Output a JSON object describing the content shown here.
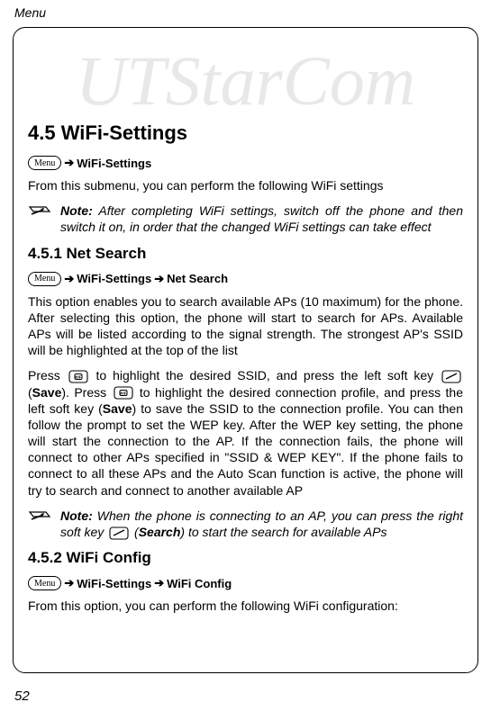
{
  "header": "Menu",
  "sections": {
    "s45": {
      "title": "4.5 WiFi-Settings",
      "nav_menu": "Menu",
      "nav1": "WiFi-Settings",
      "intro": "From this submenu, you can perform the following WiFi settings",
      "note_label": "Note:",
      "note": "After completing WiFi settings, switch off the phone and then switch it on, in order that the changed WiFi settings can take effect"
    },
    "s451": {
      "title": "4.5.1 Net Search",
      "nav_menu": "Menu",
      "nav1": "WiFi-Settings",
      "nav2": "Net Search",
      "p1": "This option enables you to search available APs (10 maximum) for the phone. After selecting this option, the phone will start to search for APs. Available APs will be listed according to the signal strength. The strongest AP's SSID will be highlighted at the top of the list",
      "p2a": "Press",
      "p2b": "to highlight the desired SSID, and press the left soft key",
      "p2c": "(",
      "save1": "Save",
      "p2d": "). Press",
      "p2e": "to highlight the desired connection profile, and press the left soft key (",
      "save2": "Save",
      "p2f": ") to save the SSID to the connection profile. You can then follow the prompt to set the WEP key. After the WEP key setting, the phone will start the connection to the AP. If the connection fails, the phone will connect to other APs specified in \"SSID & WEP KEY\". If the phone fails to connect to all these APs and the Auto Scan function is active, the phone will try to search and connect to another available AP",
      "note_label": "Note:",
      "note_a": "When the phone is connecting to an AP, you can press the right soft key",
      "note_b": "(",
      "search": "Search",
      "note_c": ") to start the search for available APs"
    },
    "s452": {
      "title": "4.5.2 WiFi Config",
      "nav_menu": "Menu",
      "nav1": "WiFi-Settings",
      "nav2": "WiFi Config",
      "p1": "From this option, you can perform the following WiFi configuration:"
    }
  },
  "watermark": "UTStarCom",
  "pagenum": "52"
}
